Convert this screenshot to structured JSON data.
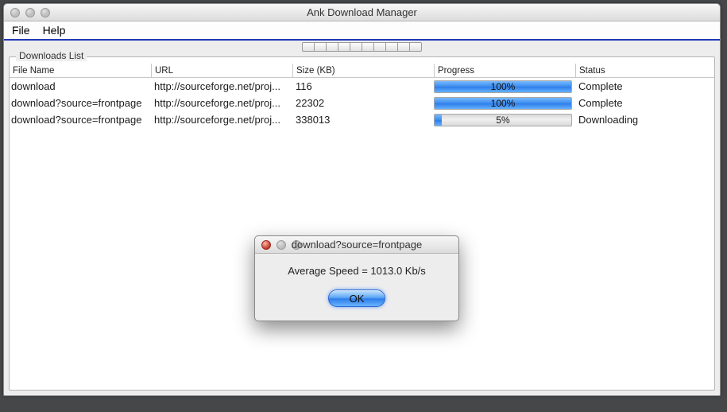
{
  "window": {
    "title": "Ank Download Manager",
    "menu": {
      "file": "File",
      "help": "Help"
    },
    "toolbar_button_count": 10
  },
  "panel": {
    "legend": "Downloads List"
  },
  "table": {
    "headers": {
      "filename": "File Name",
      "url": "URL",
      "size": "Size (KB)",
      "progress": "Progress",
      "status": "Status"
    },
    "rows": [
      {
        "filename": "download",
        "url": "http://sourceforge.net/proj...",
        "size": "116",
        "progress_pct": 100,
        "progress_label": "100%",
        "status": "Complete"
      },
      {
        "filename": "download?source=frontpage",
        "url": "http://sourceforge.net/proj...",
        "size": "22302",
        "progress_pct": 100,
        "progress_label": "100%",
        "status": "Complete"
      },
      {
        "filename": "download?source=frontpage",
        "url": "http://sourceforge.net/proj...",
        "size": "338013",
        "progress_pct": 5,
        "progress_label": "5%",
        "status": "Downloading"
      }
    ]
  },
  "dialog": {
    "title": "download?source=frontpage",
    "message": "Average Speed = 1013.0 Kb/s",
    "ok_label": "OK"
  }
}
